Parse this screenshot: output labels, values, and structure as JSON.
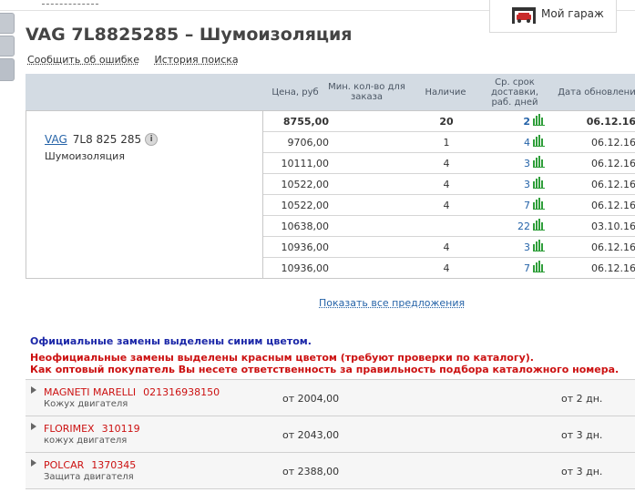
{
  "header": {
    "garage_label": "Мой гараж",
    "title": "VAG 7L8825285 – Шумоизоляция",
    "links": [
      "Сообщить об ошибке",
      "История поиска"
    ]
  },
  "offers": {
    "columns": {
      "price": "Цена, руб",
      "min_qty": "Мин. кол-во для заказа",
      "stock": "Наличие",
      "avg_days": "Ср. срок доставки, раб. дней",
      "updated": "Дата обновления"
    },
    "brand": "VAG",
    "article": "7L8 825 285",
    "info_icon": "i",
    "description": "Шумоизоляция",
    "rows": [
      {
        "price": "8755,00",
        "min_qty": "",
        "stock": "20",
        "days": "2",
        "date": "06.12.16"
      },
      {
        "price": "9706,00",
        "min_qty": "",
        "stock": "1",
        "days": "4",
        "date": "06.12.16"
      },
      {
        "price": "10111,00",
        "min_qty": "",
        "stock": "4",
        "days": "3",
        "date": "06.12.16"
      },
      {
        "price": "10522,00",
        "min_qty": "",
        "stock": "4",
        "days": "3",
        "date": "06.12.16"
      },
      {
        "price": "10522,00",
        "min_qty": "",
        "stock": "4",
        "days": "7",
        "date": "06.12.16"
      },
      {
        "price": "10638,00",
        "min_qty": "",
        "stock": "",
        "days": "22",
        "date": "03.10.16"
      },
      {
        "price": "10936,00",
        "min_qty": "",
        "stock": "4",
        "days": "3",
        "date": "06.12.16"
      },
      {
        "price": "10936,00",
        "min_qty": "",
        "stock": "4",
        "days": "7",
        "date": "06.12.16"
      }
    ],
    "show_all": "Показать все предложения"
  },
  "notes": {
    "official": "Официальные замены выделены синим цветом.",
    "unofficial": "Неофициальные замены выделены красным цветом (требуют проверки по каталогу).",
    "responsibility": "Как оптовый покупатель Вы несете ответственность за правильность подбора каталожного номера."
  },
  "replacements": [
    {
      "brand": "MAGNETI MARELLI",
      "number": "021316938150",
      "desc": "Кожух двигателя",
      "price": "от 2004,00",
      "term": "от 2 дн."
    },
    {
      "brand": "FLORIMEX",
      "number": "310119",
      "desc": "кожух двигателя",
      "price": "от 2043,00",
      "term": "от 3 дн."
    },
    {
      "brand": "POLCAR",
      "number": "1370345",
      "desc": "Защита двигателя",
      "price": "от 2388,00",
      "term": "от 3 дн."
    }
  ],
  "colors": {
    "link_blue": "#2563a8",
    "official_blue": "#1b27a8",
    "unofficial_red": "#cc1111",
    "bars_green": "#2f9e3a",
    "header_bg": "#d3dbe3"
  },
  "icons": {
    "garage": "garage-icon",
    "info": "info-icon",
    "bars": "delivery-stats-icon",
    "expand": "expand-arrow-icon"
  }
}
